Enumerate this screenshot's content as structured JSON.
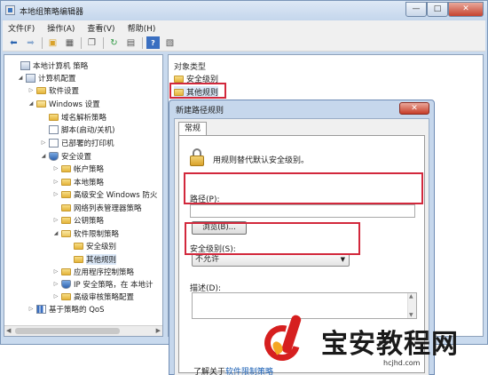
{
  "window": {
    "title": "本地组策略编辑器",
    "controls": {
      "minimize": "—",
      "maximize": "□",
      "close": "✕"
    }
  },
  "menu": [
    "文件(F)",
    "操作(A)",
    "查看(V)",
    "帮助(H)"
  ],
  "toolbar_icons": [
    "back-arrow-icon",
    "forward-arrow-icon",
    "folder-up-icon",
    "show-tree-icon",
    "copy-icon",
    "refresh-icon",
    "export-list-icon",
    "help-icon",
    "properties-icon"
  ],
  "tree": [
    {
      "label": "本地计算机 策略",
      "toggle": "",
      "icon": "pc"
    },
    {
      "label": "计算机配置",
      "toggle": "◢",
      "icon": "pc"
    },
    {
      "label": "软件设置",
      "toggle": "▷",
      "icon": "folder"
    },
    {
      "label": "Windows 设置",
      "toggle": "◢",
      "icon": "folder-open"
    },
    {
      "label": "域名解析策略",
      "toggle": "",
      "icon": "folder"
    },
    {
      "label": "脚本(启动/关机)",
      "toggle": "",
      "icon": "doc"
    },
    {
      "label": "已部署的打印机",
      "toggle": "▷",
      "icon": "doc"
    },
    {
      "label": "安全设置",
      "toggle": "◢",
      "icon": "shield"
    },
    {
      "label": "帐户策略",
      "toggle": "▷",
      "icon": "folder"
    },
    {
      "label": "本地策略",
      "toggle": "▷",
      "icon": "folder"
    },
    {
      "label": "高级安全 Windows 防火",
      "toggle": "▷",
      "icon": "folder"
    },
    {
      "label": "网络列表管理器策略",
      "toggle": "",
      "icon": "folder"
    },
    {
      "label": "公钥策略",
      "toggle": "▷",
      "icon": "folder"
    },
    {
      "label": "软件限制策略",
      "toggle": "◢",
      "icon": "folder-open"
    },
    {
      "label": "安全级别",
      "toggle": "",
      "icon": "folder"
    },
    {
      "label": "其他规则",
      "toggle": "",
      "icon": "folder"
    },
    {
      "label": "应用程序控制策略",
      "toggle": "▷",
      "icon": "folder"
    },
    {
      "label": "IP 安全策略，在 本地计",
      "toggle": "▷",
      "icon": "shield"
    },
    {
      "label": "高级审核策略配置",
      "toggle": "▷",
      "icon": "folder"
    },
    {
      "label": "基于策略的 QoS",
      "toggle": "▷",
      "icon": "chart"
    }
  ],
  "right_pane": {
    "column_header": "对象类型",
    "items": [
      "安全级别",
      "其他规则"
    ]
  },
  "dialog": {
    "title": "新建路径规则",
    "close": "✕",
    "tab": "常规",
    "description": "用规则替代默认安全级别。",
    "path_label": "路径(P):",
    "path_value": "",
    "browse_button": "浏览(B)...",
    "security_label": "安全级别(S):",
    "security_value": "不允许",
    "desc_label": "描述(D):",
    "desc_value": "",
    "learn_prefix": "了解关于",
    "learn_link": "软件限制策略"
  },
  "watermark": {
    "name": "宝安教程网",
    "url": "hcjhd.com"
  },
  "colors": {
    "highlight": "#d2283c",
    "link": "#1a5fb4",
    "window_frame": "#c9daee"
  }
}
